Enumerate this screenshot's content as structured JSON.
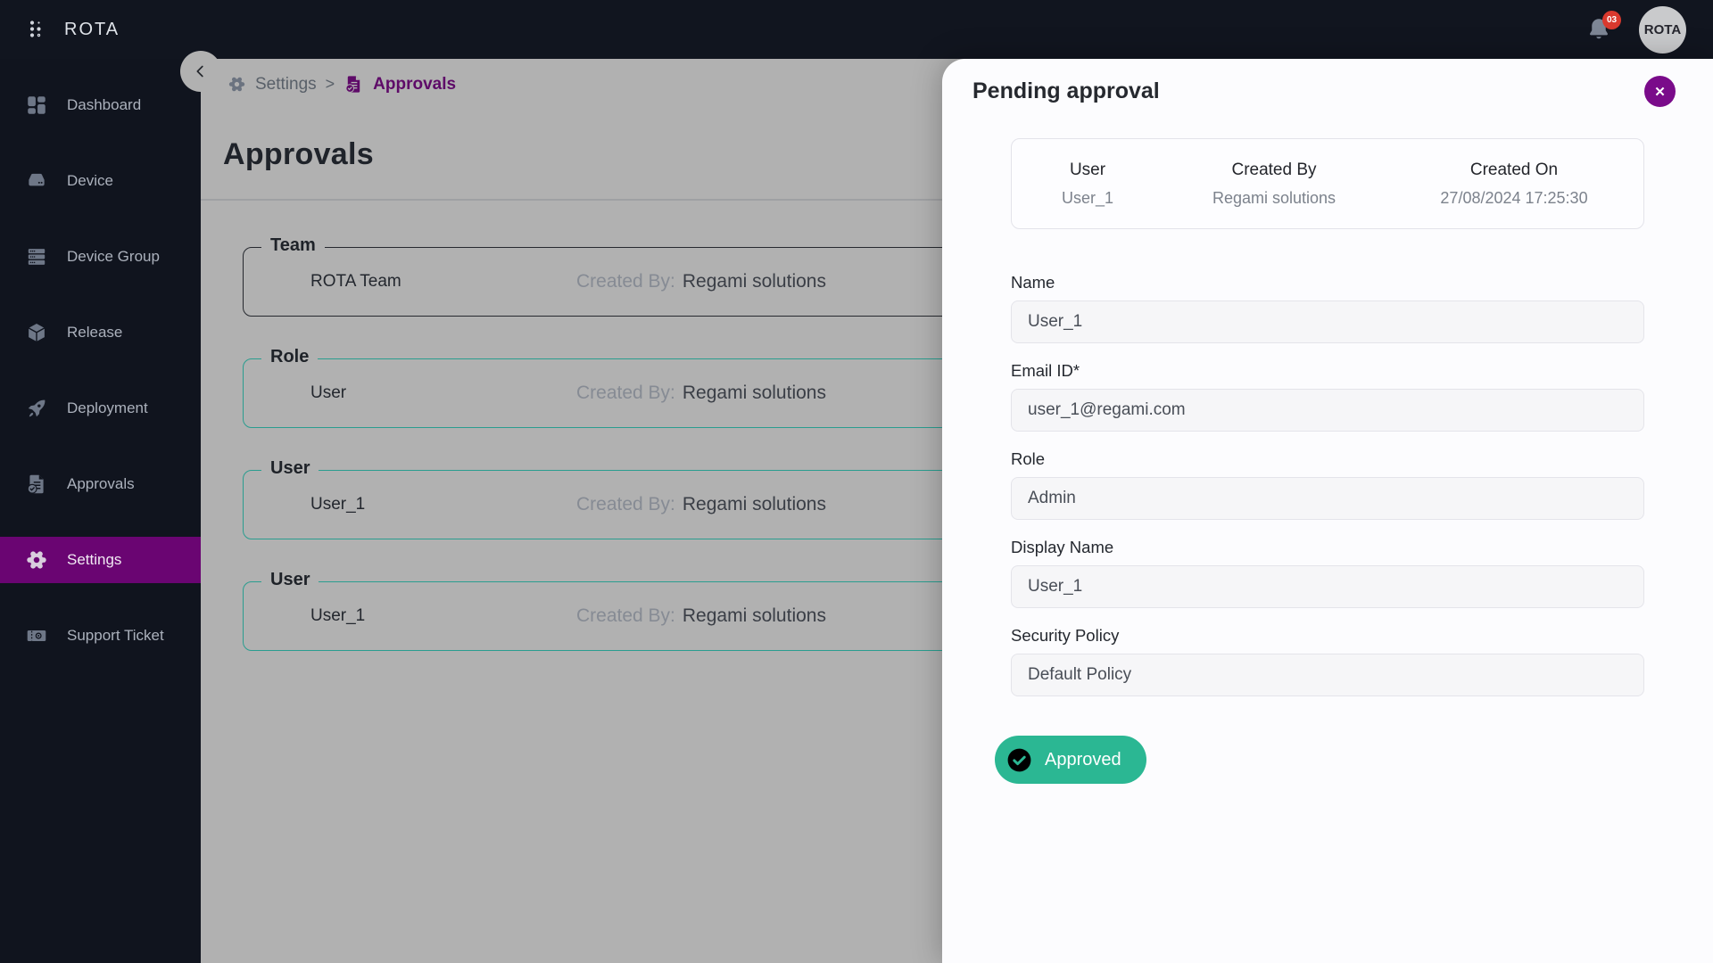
{
  "colors": {
    "topbar-bg": "#11151f",
    "sidebar-bg": "#10141e",
    "active-purple": "#6a0572",
    "breadcrumb-purple": "#5e0a68",
    "close-purple": "#7a0b8a",
    "teal": "#2bb793",
    "card-teal": "#2a9d8f",
    "card-dark": "#26292f",
    "backdrop": "#b1b1b1",
    "panel-bg": "#fcfcfe",
    "badge-red": "#d9392e"
  },
  "app": {
    "brand": "ROTA",
    "notification_count": "03",
    "avatar_text": "ROTA"
  },
  "sidebar": {
    "items": [
      {
        "label": "Dashboard"
      },
      {
        "label": "Device"
      },
      {
        "label": "Device Group"
      },
      {
        "label": "Release"
      },
      {
        "label": "Deployment"
      },
      {
        "label": "Approvals"
      },
      {
        "label": "Settings"
      },
      {
        "label": "Support Ticket"
      }
    ]
  },
  "breadcrumb": {
    "parent": "Settings",
    "separator": ">",
    "current": "Approvals"
  },
  "main": {
    "title": "Approvals",
    "groups": [
      {
        "legend": "Team",
        "name": "ROTA Team",
        "created_by_label": "Created By:",
        "created_by": "Regami solutions"
      },
      {
        "legend": "Role",
        "name": "User",
        "created_by_label": "Created By:",
        "created_by": "Regami solutions"
      },
      {
        "legend": "User",
        "name": "User_1",
        "created_by_label": "Created By:",
        "created_by": "Regami solutions"
      },
      {
        "legend": "User",
        "name": "User_1",
        "created_by_label": "Created By:",
        "created_by": "Regami solutions"
      }
    ]
  },
  "panel": {
    "title": "Pending approval",
    "close_icon": "✕",
    "summary": {
      "columns": [
        {
          "header": "User",
          "value": "User_1"
        },
        {
          "header": "Created By",
          "value": "Regami solutions"
        },
        {
          "header": "Created On",
          "value": "27/08/2024 17:25:30"
        }
      ]
    },
    "fields": [
      {
        "label": "Name",
        "value": "User_1"
      },
      {
        "label": "Email ID*",
        "value": "user_1@regami.com"
      },
      {
        "label": "Role",
        "value": "Admin"
      },
      {
        "label": "Display Name",
        "value": "User_1"
      },
      {
        "label": "Security Policy",
        "value": "Default Policy"
      }
    ],
    "approve_label": "Approved"
  }
}
